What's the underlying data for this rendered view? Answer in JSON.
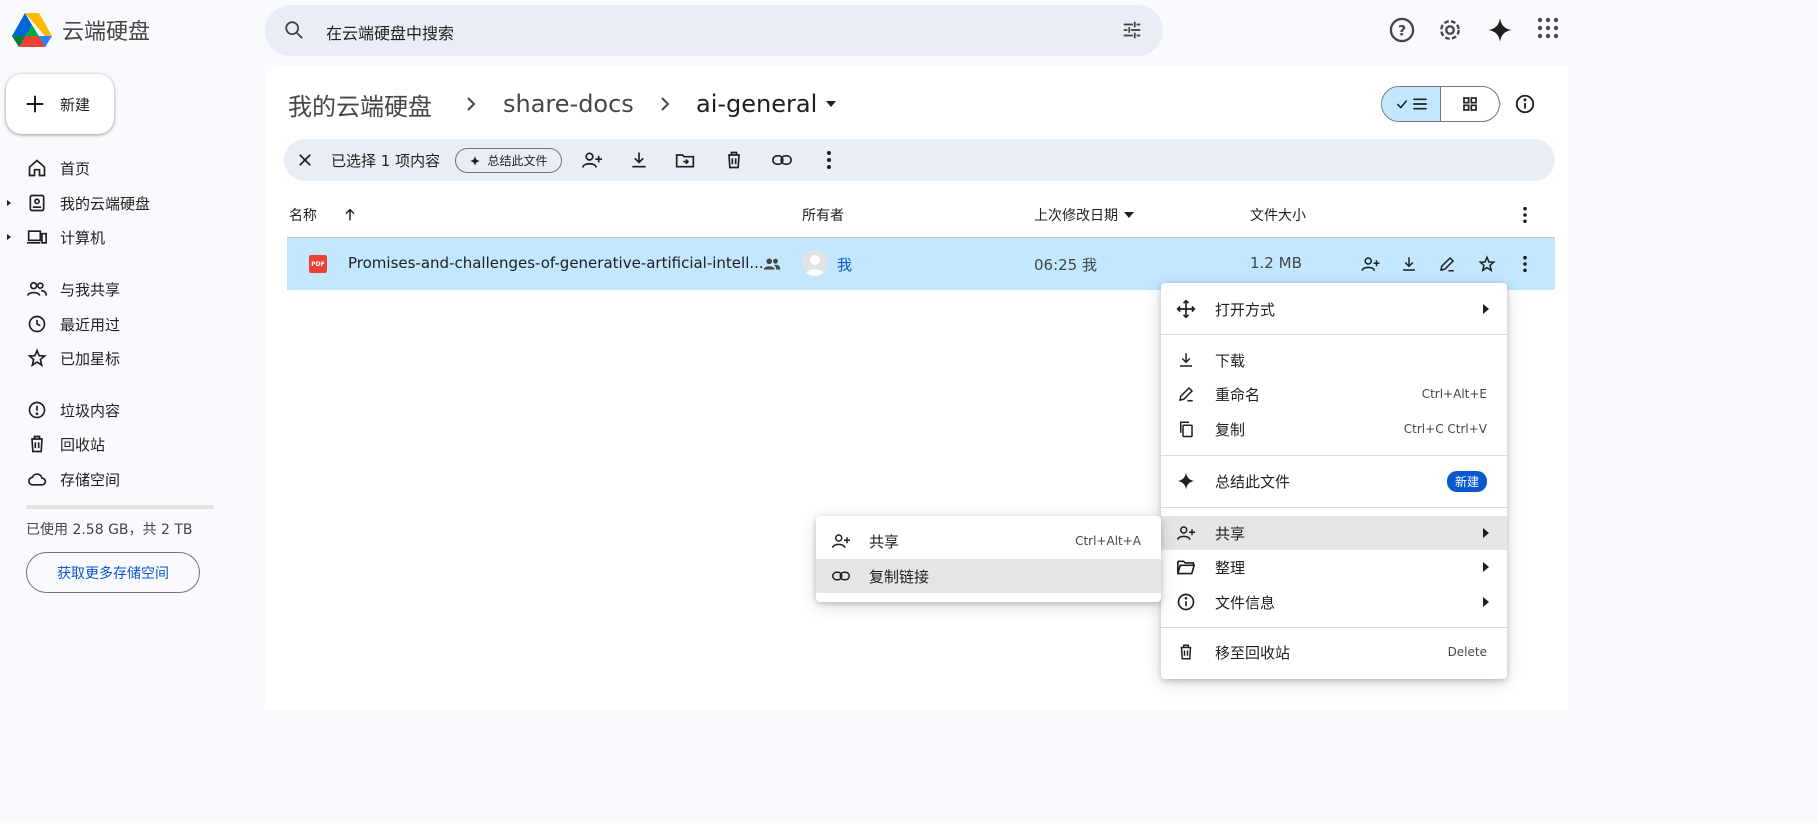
{
  "app": {
    "title": "云端硬盘"
  },
  "search": {
    "placeholder": "在云端硬盘中搜索"
  },
  "sidebar": {
    "new_label": "新建",
    "items": [
      {
        "label": "首页",
        "icon": "home-icon"
      },
      {
        "label": "我的云端硬盘",
        "icon": "my-drive-icon"
      },
      {
        "label": "计算机",
        "icon": "computer-icon"
      },
      {
        "label": "与我共享",
        "icon": "shared-icon"
      },
      {
        "label": "最近用过",
        "icon": "clock-icon"
      },
      {
        "label": "已加星标",
        "icon": "star-icon"
      },
      {
        "label": "垃圾内容",
        "icon": "spam-icon"
      },
      {
        "label": "回收站",
        "icon": "trash-icon"
      },
      {
        "label": "存储空间",
        "icon": "cloud-icon"
      }
    ],
    "storage_text": "已使用 2.58 GB，共 2 TB",
    "storage_button": "获取更多存储空间"
  },
  "breadcrumb": {
    "root": "我的云端硬盘",
    "mid": "share-docs",
    "current": "ai-general"
  },
  "selection_bar": {
    "text": "已选择 1 项内容",
    "summarize_label": "总结此文件"
  },
  "table": {
    "headers": {
      "name": "名称",
      "owner": "所有者",
      "modified": "上次修改日期",
      "size": "文件大小"
    },
    "rows": [
      {
        "file_type": "PDF",
        "name": "Promises-and-challenges-of-generative-artificial-intell...",
        "owner": "我",
        "modified": "06:25 我",
        "size": "1.2 MB"
      }
    ]
  },
  "context_menu": {
    "open_with": "打开方式",
    "download": "下载",
    "rename": "重命名",
    "rename_shortcut": "Ctrl+Alt+E",
    "copy": "复制",
    "copy_shortcut": "Ctrl+C Ctrl+V",
    "summarize": "总结此文件",
    "summarize_badge": "新建",
    "share": "共享",
    "organize": "整理",
    "file_info": "文件信息",
    "trash": "移至回收站",
    "trash_shortcut": "Delete"
  },
  "share_submenu": {
    "share": "共享",
    "share_shortcut": "Ctrl+Alt+A",
    "copy_link": "复制链接"
  },
  "colors": {
    "accent": "#0b57d0",
    "selection": "#c2e7ff",
    "surface": "#f8fafd"
  }
}
